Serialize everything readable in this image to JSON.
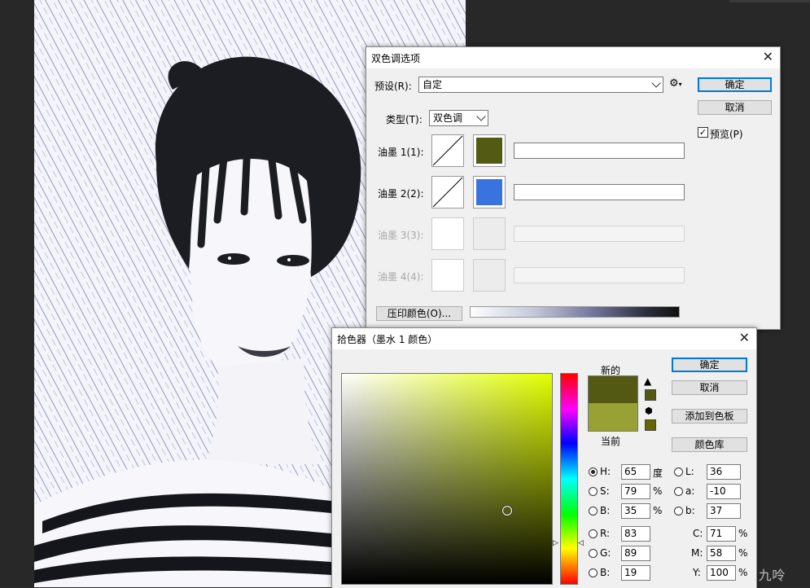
{
  "duotone": {
    "title": "双色调选项",
    "preset_label": "预设(R):",
    "preset_value": "自定",
    "gear_icon": "gear-icon",
    "type_label": "类型(T):",
    "type_value": "双色调",
    "ok": "确定",
    "cancel": "取消",
    "preview": "预览(P)",
    "preview_checked": true,
    "inks": [
      {
        "label": "油墨 1(1):",
        "color": "#535a13",
        "enabled": true
      },
      {
        "label": "油墨 2(2):",
        "color": "#3a73e0",
        "enabled": true
      },
      {
        "label": "油墨 3(3):",
        "color": "",
        "enabled": false
      },
      {
        "label": "油墨 4(4):",
        "color": "",
        "enabled": false
      }
    ],
    "overprint": "压印颜色(O)..."
  },
  "picker": {
    "title": "拾色器（墨水 1 颜色）",
    "new_label": "新的",
    "current_label": "当前",
    "new_color": "#535913",
    "current_color": "#98a234",
    "hue_color": "#e2ff00",
    "ok": "确定",
    "cancel": "取消",
    "add_swatch": "添加到色板",
    "color_lib": "颜色库",
    "fields": {
      "H": {
        "label": "H:",
        "value": "65",
        "unit": "度"
      },
      "S": {
        "label": "S:",
        "value": "79",
        "unit": "%"
      },
      "Bv": {
        "label": "B:",
        "value": "35",
        "unit": "%"
      },
      "R": {
        "label": "R:",
        "value": "83"
      },
      "G": {
        "label": "G:",
        "value": "89"
      },
      "Bb": {
        "label": "B:",
        "value": "19"
      },
      "L": {
        "label": "L:",
        "value": "36"
      },
      "a": {
        "label": "a:",
        "value": "-10"
      },
      "b": {
        "label": "b:",
        "value": "37"
      },
      "C": {
        "label": "C:",
        "value": "71",
        "unit": "%"
      },
      "M": {
        "label": "M:",
        "value": "58",
        "unit": "%"
      },
      "Y": {
        "label": "Y:",
        "value": "100",
        "unit": "%"
      }
    }
  },
  "watermark": "CSDN @一只九呤"
}
